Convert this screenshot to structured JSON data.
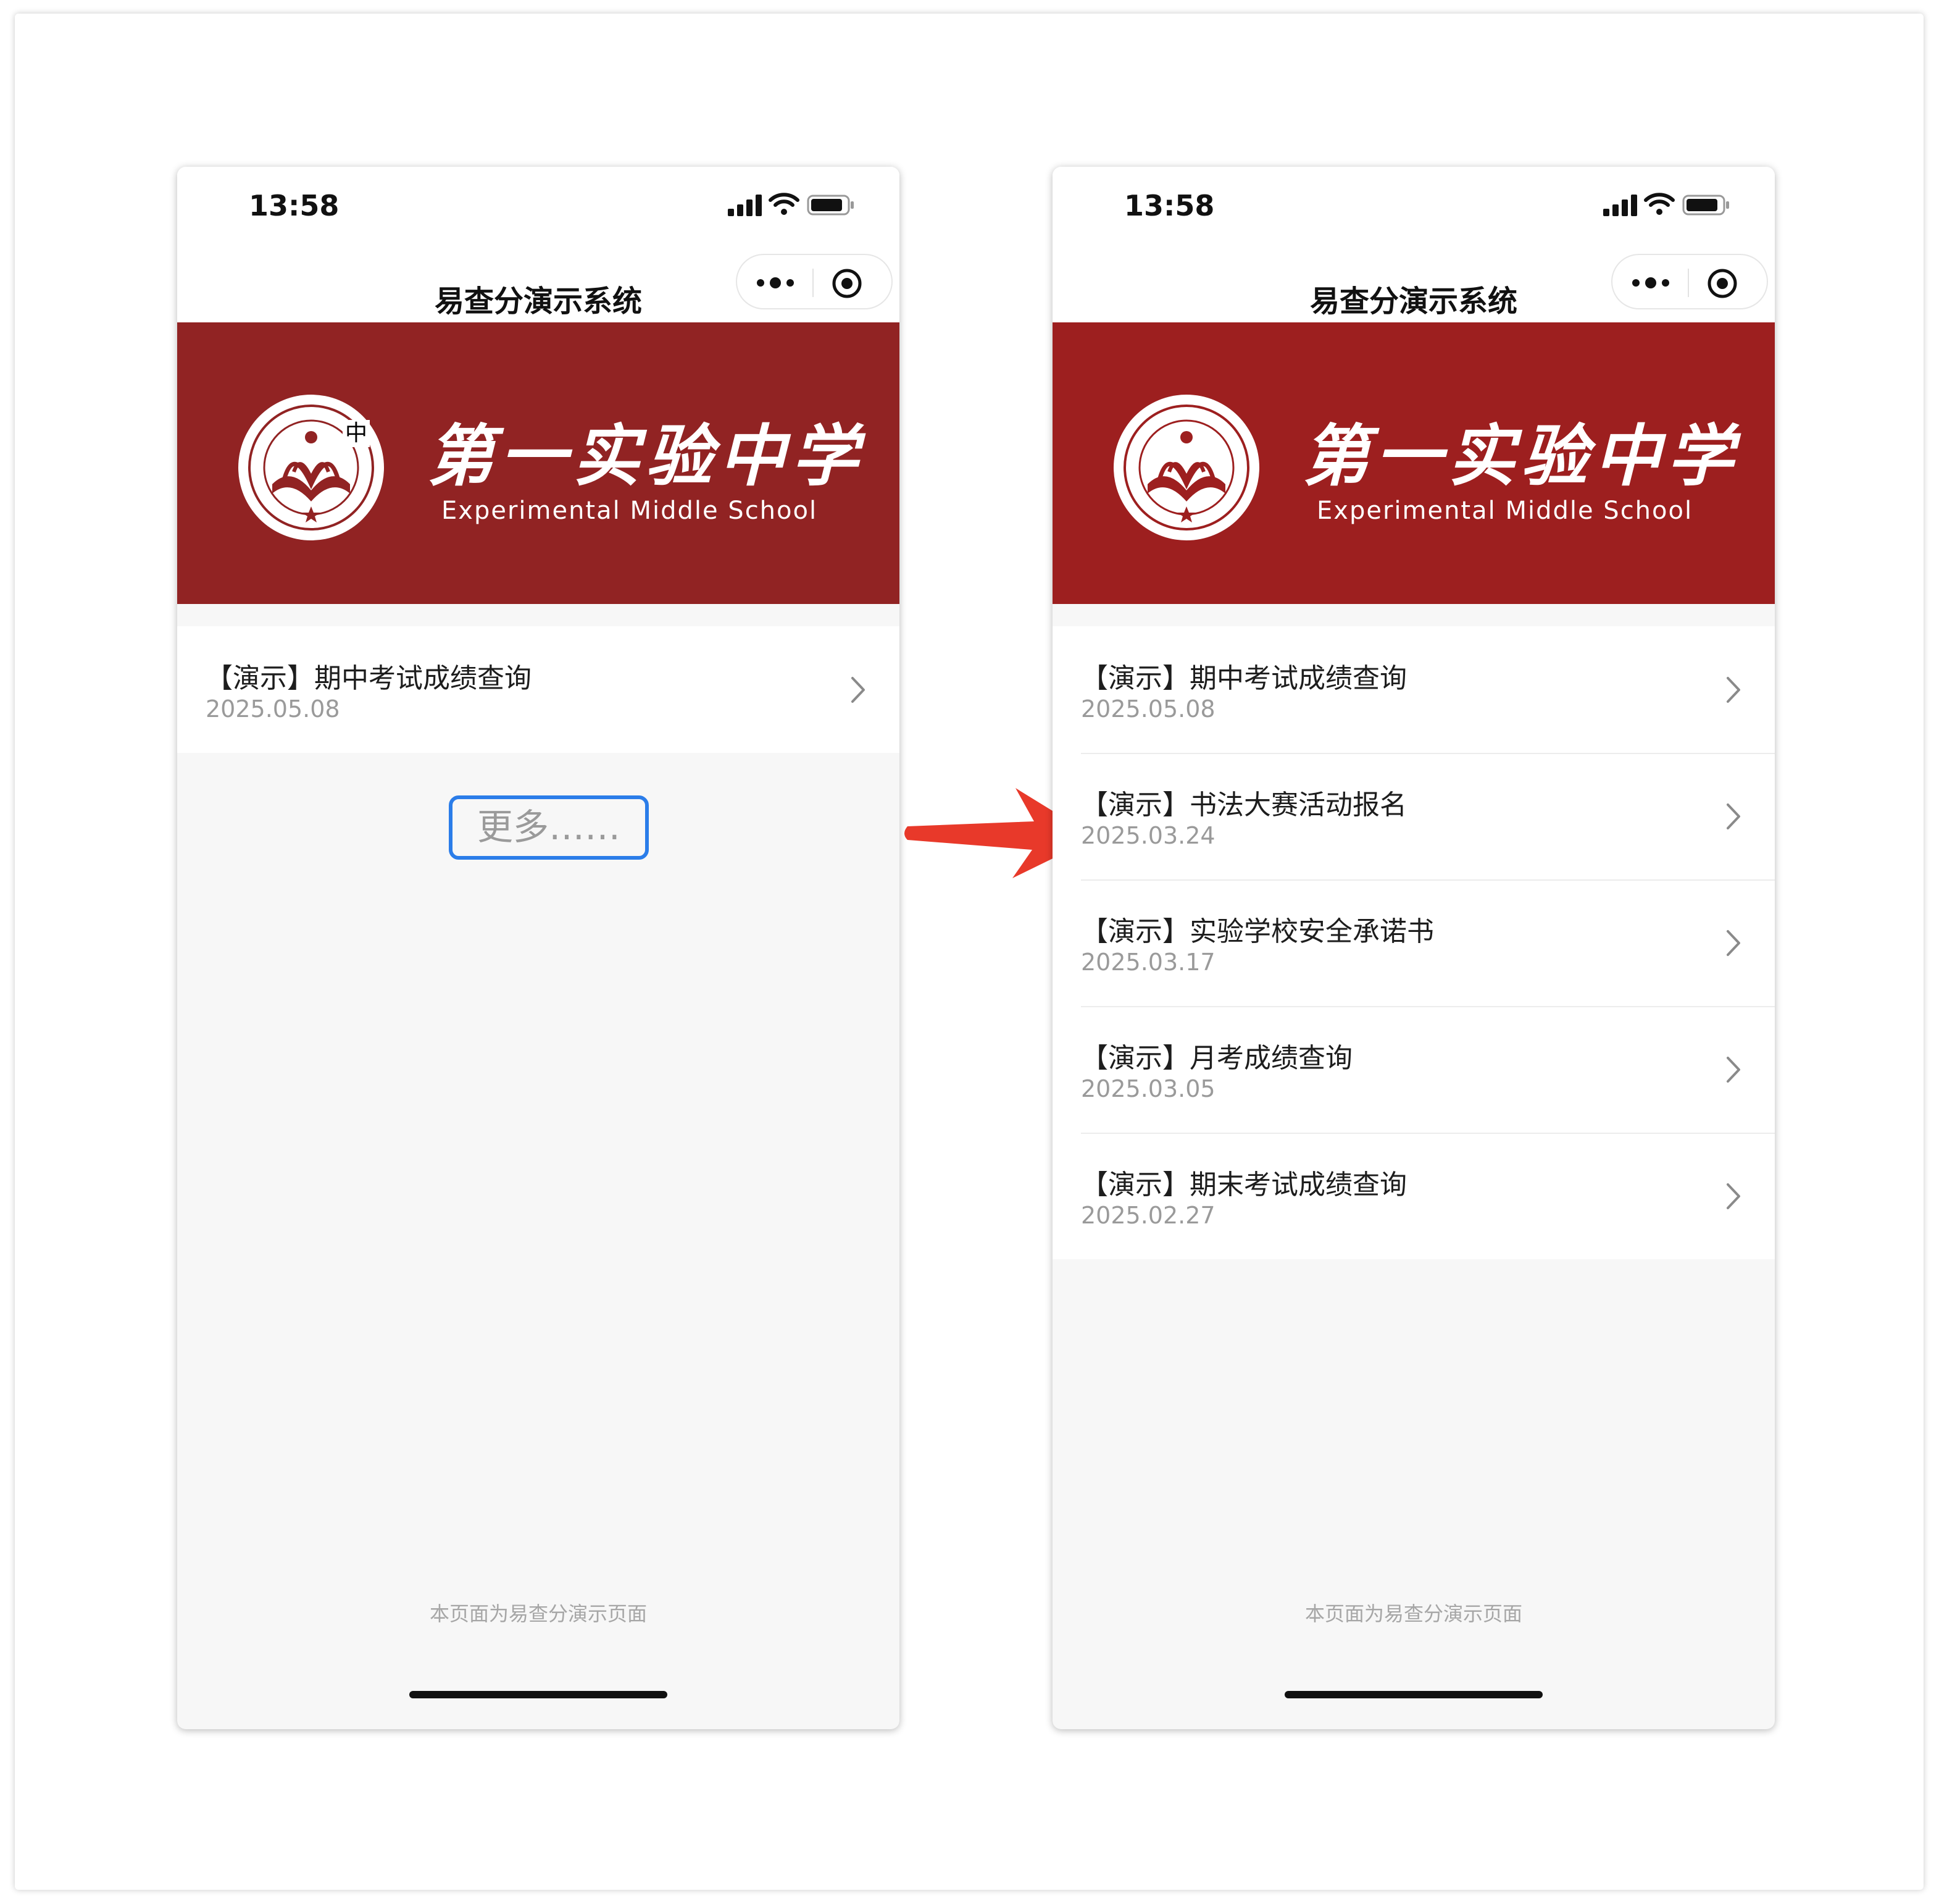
{
  "screens": {
    "before": {
      "status": {
        "time": "13:58"
      },
      "nav": {
        "title": "易查分演示系统",
        "more_icon": "more-dots-icon",
        "close_icon": "target-icon"
      },
      "banner": {
        "name_cn": "第一实验中学",
        "name_en": "Experimental Middle School",
        "ime_char": "中"
      },
      "items": [
        {
          "title": "【演示】期中考试成绩查询",
          "date": "2025.05.08"
        }
      ],
      "more_button": "更多……",
      "footer": "本页面为易查分演示页面"
    },
    "after": {
      "status": {
        "time": "13:58"
      },
      "nav": {
        "title": "易查分演示系统",
        "more_icon": "more-dots-icon",
        "close_icon": "target-icon"
      },
      "banner": {
        "name_cn": "第一实验中学",
        "name_en": "Experimental Middle School"
      },
      "items": [
        {
          "title": "【演示】期中考试成绩查询",
          "date": "2025.05.08"
        },
        {
          "title": "【演示】书法大赛活动报名",
          "date": "2025.03.24"
        },
        {
          "title": "【演示】实验学校安全承诺书",
          "date": "2025.03.17"
        },
        {
          "title": "【演示】月考成绩查询",
          "date": "2025.03.05"
        },
        {
          "title": "【演示】期末考试成绩查询",
          "date": "2025.02.27"
        }
      ],
      "footer": "本页面为易查分演示页面"
    }
  },
  "colors": {
    "banner": "#912323",
    "accent_outline": "#2b7de9",
    "arrow": "#e8392a"
  }
}
